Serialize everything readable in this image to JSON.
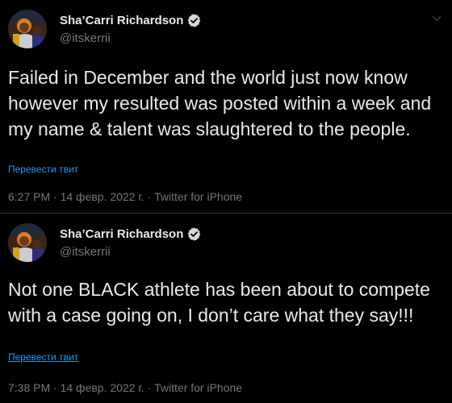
{
  "colors": {
    "background": "#000000",
    "text": "#e7e9ea",
    "muted": "#71767b",
    "link": "#1d9bf0",
    "verified": "#d9d9d9"
  },
  "tweets": [
    {
      "display_name": "Sha’Carri Richardson",
      "handle": "@itskerrii",
      "verified_icon": "verified-badge-icon",
      "text": "Failed in December and the world just now know however my resulted was posted within a week and my name & talent was slaughtered to the people.",
      "translate": "Перевести твит",
      "time": "6:27 PM",
      "separator": " · ",
      "date": "14 февр. 2022 г.",
      "separator2": " · ",
      "source": "Twitter for iPhone"
    },
    {
      "display_name": "Sha’Carri Richardson",
      "handle": "@itskerrii",
      "verified_icon": "verified-badge-icon",
      "text": "Not one BLACK athlete has been about to compete with a case going on, I don’t care what they say!!!",
      "translate": "Перевести твит",
      "time": "7:38 PM",
      "separator": " · ",
      "date": "14 февр. 2022 г.",
      "separator2": " · ",
      "source": "Twitter for iPhone"
    }
  ]
}
